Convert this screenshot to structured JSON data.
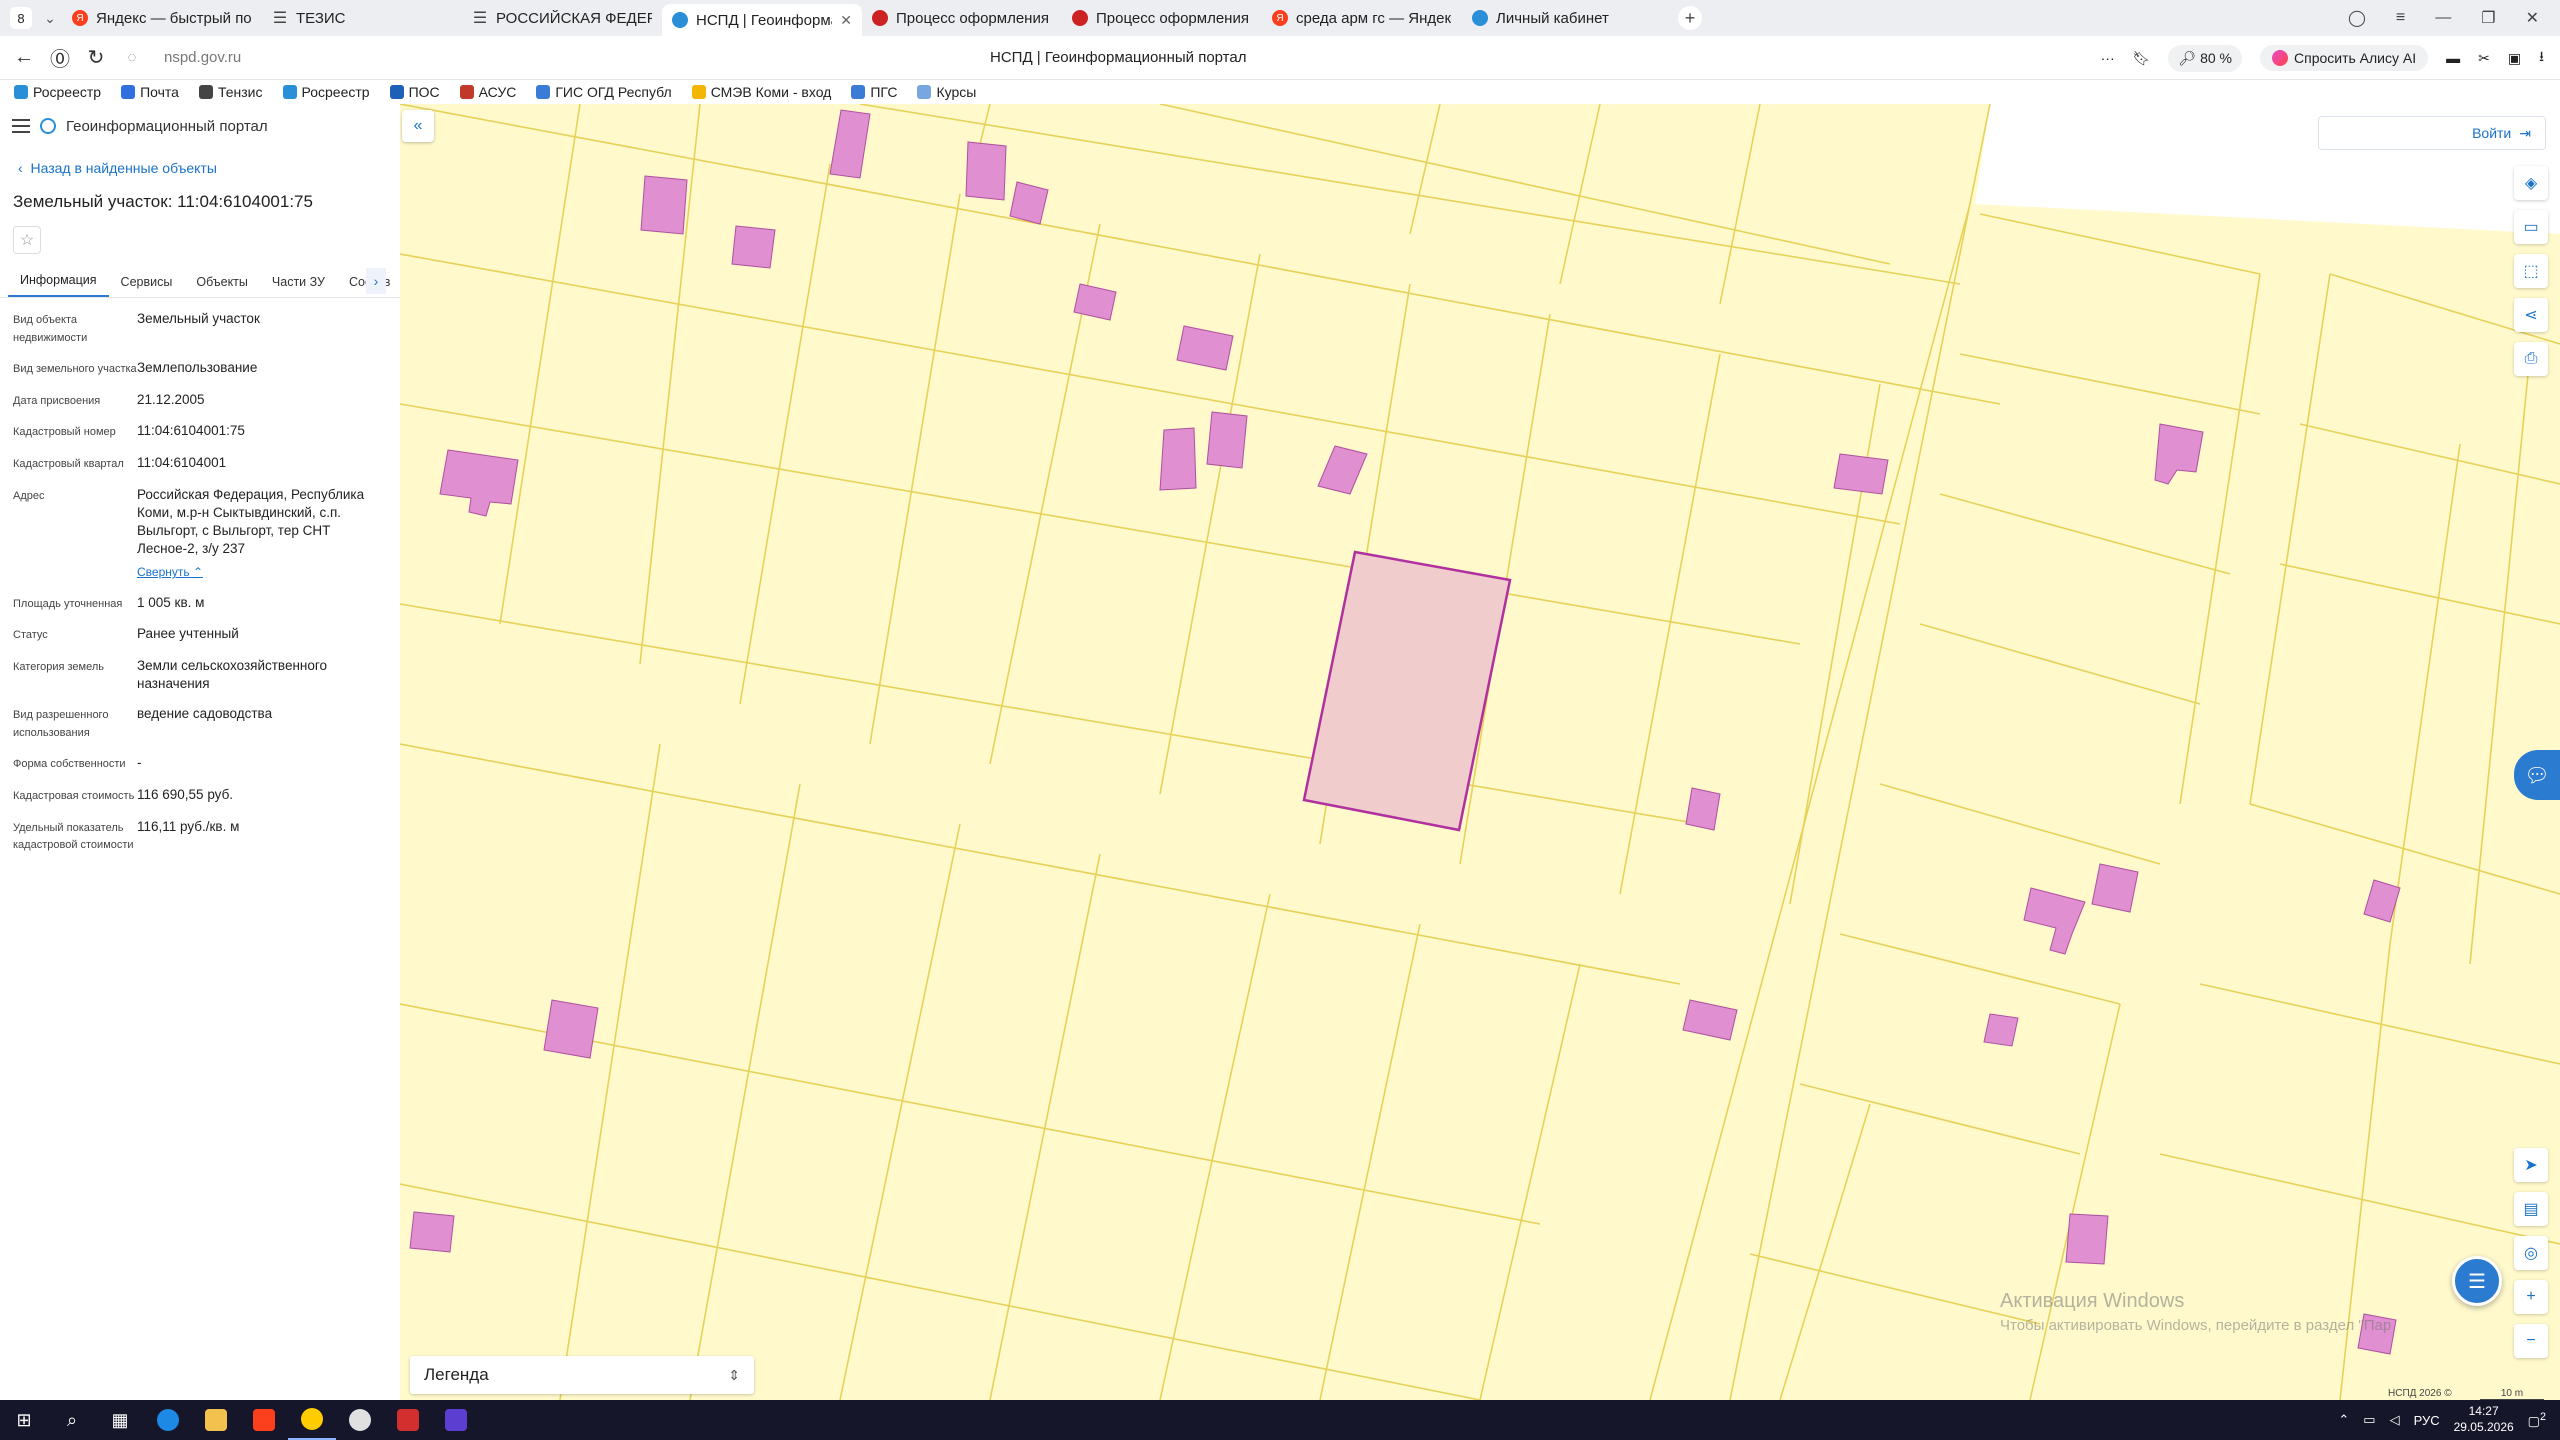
{
  "browser": {
    "tab_counter": "8",
    "tabs": [
      {
        "title": "Яндекс — быстрый поиск",
        "icon": "yandex-icon",
        "color": "#fc3f1d"
      },
      {
        "title": "ТЕЗИС",
        "icon": "menu-icon",
        "color": "#444444"
      },
      {
        "title": "РОССИЙСКАЯ ФЕДЕРАЦИЯ",
        "icon": "menu-icon",
        "color": "#444444"
      },
      {
        "title": "НСПД | Геоинформаци",
        "icon": "nspd-icon",
        "color": "#2b8fd8",
        "active": true
      },
      {
        "title": "Процесс оформления арх",
        "icon": "doc-icon",
        "color": "#cc2222"
      },
      {
        "title": "Процесс оформления арх",
        "icon": "doc-icon",
        "color": "#cc2222"
      },
      {
        "title": "среда арм гс — Яндекс: на",
        "icon": "yandex-icon",
        "color": "#fc3f1d"
      },
      {
        "title": "Личный кабинет",
        "icon": "rosreestr-icon",
        "color": "#2b8fd8"
      }
    ],
    "url": "nspd.gov.ru",
    "page_title": "НСПД | Геоинформационный портал",
    "zoom": "80 %",
    "alisa": "Спросить Алису AI",
    "bookmarks": [
      {
        "label": "Росреестр",
        "color": "#2b8fd8"
      },
      {
        "label": "Почта",
        "color": "#2f6fe0"
      },
      {
        "label": "Тензис",
        "color": "#444444"
      },
      {
        "label": "Росреестр",
        "color": "#2b8fd8"
      },
      {
        "label": "ПОС",
        "color": "#1e5fb8"
      },
      {
        "label": "АСУС",
        "color": "#c0392b"
      },
      {
        "label": "ГИС ОГД Республ",
        "color": "#3a7bd5"
      },
      {
        "label": "СМЭВ Коми - вход",
        "color": "#f2b705"
      },
      {
        "label": "ПГС",
        "color": "#3a7bd5"
      },
      {
        "label": "Курсы",
        "color": "#7aa6e0"
      }
    ]
  },
  "panel": {
    "portal_name": "Геоинформационный портал",
    "back_link": "Назад в найденные объекты",
    "title": "Земельный участок: 11:04:6104001:75",
    "tabs": [
      "Информация",
      "Сервисы",
      "Объекты",
      "Части ЗУ",
      "Состав"
    ],
    "attributes": [
      {
        "key": "Вид объекта недвижимости",
        "value": "Земельный участок"
      },
      {
        "key": "Вид земельного участка",
        "value": "Землепользование"
      },
      {
        "key": "Дата присвоения",
        "value": "21.12.2005"
      },
      {
        "key": "Кадастровый номер",
        "value": "11:04:6104001:75"
      },
      {
        "key": "Кадастровый квартал",
        "value": "11:04:6104001"
      },
      {
        "key": "Адрес",
        "value": "Российская Федерация, Республика Коми, м.р-н Сыктывдинский, с.п. Выльгорт, с Выльгорт, тер СНТ Лесное-2, з/у 237"
      },
      {
        "key": "Площадь уточненная",
        "value": "1 005 кв. м"
      },
      {
        "key": "Статус",
        "value": "Ранее учтенный"
      },
      {
        "key": "Категория земель",
        "value": "Земли сельскохозяйственного назначения"
      },
      {
        "key": "Вид разрешенного использования",
        "value": "ведение садоводства"
      },
      {
        "key": "Форма собственности",
        "value": "-"
      },
      {
        "key": "Кадастровая стоимость",
        "value": "116 690,55 руб."
      },
      {
        "key": "Удельный показатель кадастровой стоимости",
        "value": "116,11 руб./кв. м"
      }
    ],
    "collapse_link": "Свернуть"
  },
  "map": {
    "login": "Войти",
    "legend": "Легенда",
    "watermark_title": "Активация Windows",
    "watermark_text": "Чтобы активировать Windows, перейдите в раздел \"Пар",
    "copyright": "НСПД 2026 ©",
    "scale": "10 m",
    "colors": {
      "parcel_fill": "#fff9cc",
      "parcel_line": "#e6d25a",
      "building": "#e08fd0",
      "selected_fill": "#f0cccc",
      "selected_line": "#b030a0"
    }
  },
  "taskbar": {
    "lang": "РУС",
    "time": "14:27",
    "date": "29.05.2026",
    "notif_count": "2"
  }
}
